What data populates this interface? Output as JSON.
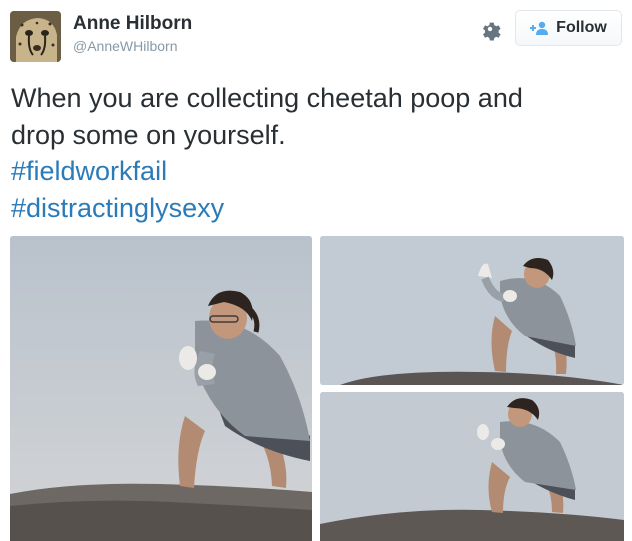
{
  "author": {
    "display_name": "Anne Hilborn",
    "screen_name": "@AnneWHilborn",
    "avatar_icon": "cheetah-avatar"
  },
  "actions": {
    "settings_icon": "gear-icon",
    "follow_icon": "add-user-icon",
    "follow_label": "Follow"
  },
  "tweet": {
    "text_line_1": "When you are collecting cheetah poop and",
    "text_line_2": "drop some on yourself.",
    "hashtags": [
      "#fieldworkfail",
      "#distractinglysexy"
    ]
  },
  "colors": {
    "link": "#2b7bb9",
    "text": "#292f33",
    "muted": "#8899a6"
  }
}
